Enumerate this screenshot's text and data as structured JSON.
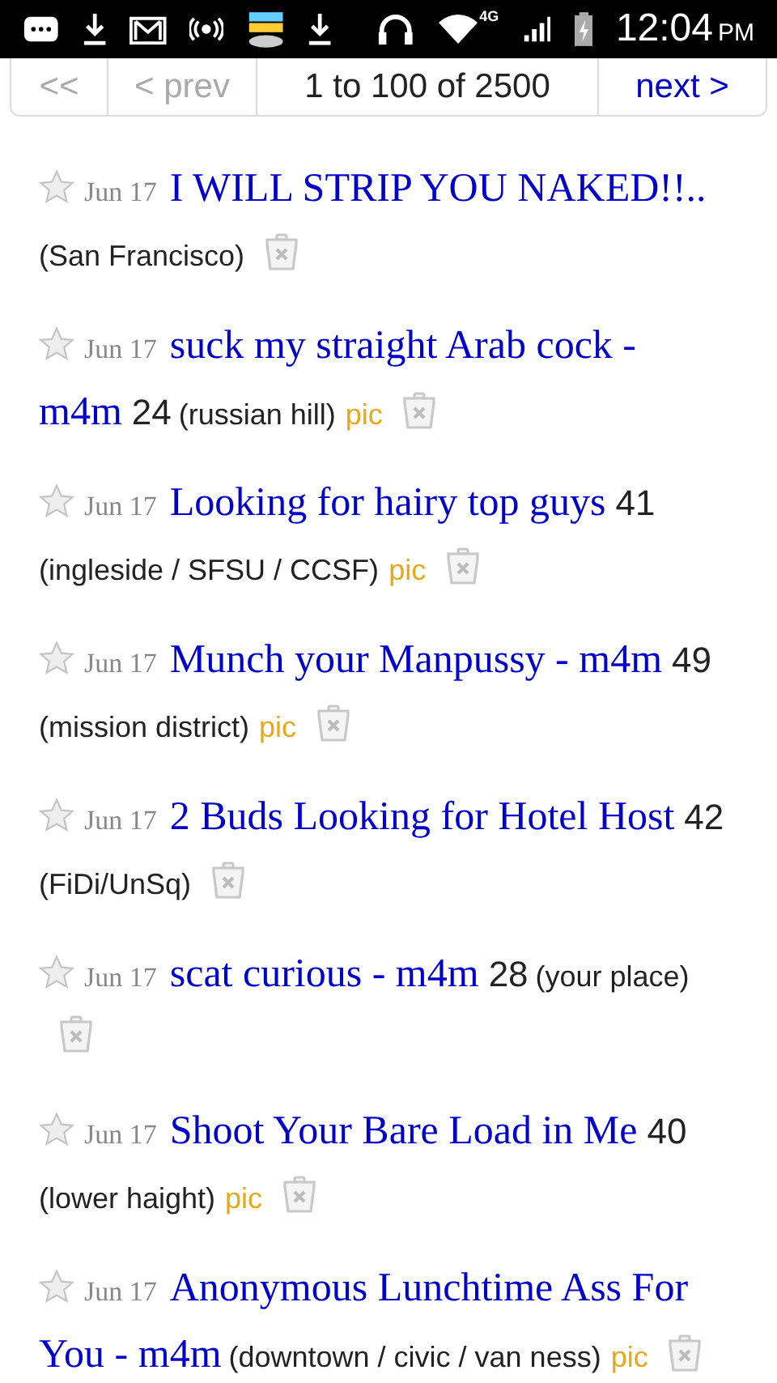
{
  "status_bar": {
    "time": "12:04",
    "ampm": "PM",
    "network": "4G"
  },
  "pagination": {
    "buttons": [
      {
        "label": "<<",
        "disabled": true
      },
      {
        "label": "< prev",
        "disabled": true
      }
    ],
    "range": "1 to 100 of 2500",
    "next": {
      "label": "next >",
      "disabled": false
    }
  },
  "posts": [
    {
      "favorite": false,
      "date": "Jun 17",
      "title_lines": [
        "I WILL STRIP YOU NAKED!!.."
      ],
      "hood": "(San Francisco)"
    },
    {
      "favorite": false,
      "date": "Jun 17",
      "title_lines": [
        "suck my straight Arab cock -",
        "m4m"
      ],
      "age": "24",
      "hood": "(russian hill)",
      "pic": "pic"
    },
    {
      "favorite": false,
      "date": "Jun 17",
      "title_lines": [
        "Looking for hairy top guys"
      ],
      "age": "41",
      "hood": "(ingleside / SFSU / CCSF)",
      "pic": "pic"
    },
    {
      "favorite": false,
      "date": "Jun 17",
      "title_lines": [
        "Munch your Manpussy - m4m"
      ],
      "age": "49",
      "hood": "(mission district)",
      "pic": "pic"
    },
    {
      "favorite": false,
      "date": "Jun 17",
      "title_lines": [
        "2 Buds Looking for Hotel Host"
      ],
      "age": "42",
      "hood": "(FiDi/UnSq)"
    },
    {
      "favorite": false,
      "date": "Jun 17",
      "title_lines": [
        "scat curious - m4m"
      ],
      "age": "28",
      "hood": "(your place)"
    },
    {
      "favorite": false,
      "date": "Jun 17",
      "title_lines": [
        "Shoot Your Bare Load in Me"
      ],
      "age": "40",
      "hood": "(lower haight)",
      "pic": "pic"
    },
    {
      "favorite": false,
      "date": "Jun 17",
      "title_lines": [
        "Anonymous Lunchtime Ass For",
        "You - m4m"
      ],
      "hood": "(downtown / civic / van ness)",
      "pic": "pic"
    }
  ]
}
